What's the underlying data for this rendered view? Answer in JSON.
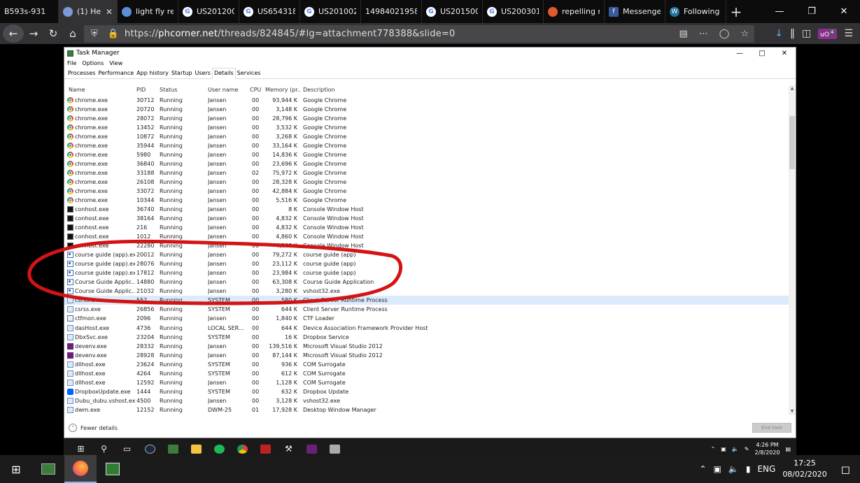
{
  "browser": {
    "tabs": [
      {
        "title": "B593s-931",
        "favicon": "none",
        "color": "#0c0c0d"
      },
      {
        "title": "(1) Hel",
        "favicon": "cube-icon",
        "color": "#7b9bd8",
        "active": true
      },
      {
        "title": "light fly re",
        "favicon": "bird-icon",
        "color": "#5a8fd8"
      },
      {
        "title": "US201200",
        "favicon": "google-icon",
        "color": "#ffffff"
      },
      {
        "title": "US654318",
        "favicon": "google-icon",
        "color": "#ffffff"
      },
      {
        "title": "US201002",
        "favicon": "google-icon",
        "color": "#ffffff"
      },
      {
        "title": "149840219585",
        "favicon": "none",
        "color": "#ffffff"
      },
      {
        "title": "US201500",
        "favicon": "google-icon",
        "color": "#ffffff"
      },
      {
        "title": "US200301",
        "favicon": "google-icon",
        "color": "#ffffff"
      },
      {
        "title": "repelling r",
        "favicon": "shield-icon",
        "color": "#e05a2b"
      },
      {
        "title": "Messenge",
        "favicon": "facebook-icon",
        "color": "#3b5998"
      },
      {
        "title": "Following",
        "favicon": "wordpress-icon",
        "color": "#21759b"
      }
    ],
    "new_tab": "+",
    "url_prefix": "https://",
    "url_domain": "phcorner.net",
    "url_path": "/threads/824845/#lg=attachment778388&slide=0",
    "extension_badge": "4"
  },
  "task_manager": {
    "title": "Task Manager",
    "menu": [
      "File",
      "Options",
      "View"
    ],
    "tabs": [
      "Processes",
      "Performance",
      "App history",
      "Startup",
      "Users",
      "Details",
      "Services"
    ],
    "active_tab": "Details",
    "columns": {
      "name": "Name",
      "pid": "PID",
      "status": "Status",
      "user": "User name",
      "cpu": "CPU",
      "mem": "Memory (pr...",
      "desc": "Description"
    },
    "rows": [
      {
        "name": "chrome.exe",
        "pid": "30712",
        "status": "Running",
        "user": "Jansen",
        "cpu": "00",
        "mem": "93,944 K",
        "desc": "Google Chrome",
        "icon": "chrome"
      },
      {
        "name": "chrome.exe",
        "pid": "20720",
        "status": "Running",
        "user": "Jansen",
        "cpu": "00",
        "mem": "3,148 K",
        "desc": "Google Chrome",
        "icon": "chrome"
      },
      {
        "name": "chrome.exe",
        "pid": "28072",
        "status": "Running",
        "user": "Jansen",
        "cpu": "00",
        "mem": "28,796 K",
        "desc": "Google Chrome",
        "icon": "chrome"
      },
      {
        "name": "chrome.exe",
        "pid": "13452",
        "status": "Running",
        "user": "Jansen",
        "cpu": "00",
        "mem": "3,532 K",
        "desc": "Google Chrome",
        "icon": "chrome"
      },
      {
        "name": "chrome.exe",
        "pid": "10872",
        "status": "Running",
        "user": "Jansen",
        "cpu": "00",
        "mem": "3,268 K",
        "desc": "Google Chrome",
        "icon": "chrome"
      },
      {
        "name": "chrome.exe",
        "pid": "35944",
        "status": "Running",
        "user": "Jansen",
        "cpu": "00",
        "mem": "33,164 K",
        "desc": "Google Chrome",
        "icon": "chrome"
      },
      {
        "name": "chrome.exe",
        "pid": "5980",
        "status": "Running",
        "user": "Jansen",
        "cpu": "00",
        "mem": "14,836 K",
        "desc": "Google Chrome",
        "icon": "chrome"
      },
      {
        "name": "chrome.exe",
        "pid": "36840",
        "status": "Running",
        "user": "Jansen",
        "cpu": "00",
        "mem": "23,696 K",
        "desc": "Google Chrome",
        "icon": "chrome"
      },
      {
        "name": "chrome.exe",
        "pid": "33188",
        "status": "Running",
        "user": "Jansen",
        "cpu": "02",
        "mem": "75,972 K",
        "desc": "Google Chrome",
        "icon": "chrome"
      },
      {
        "name": "chrome.exe",
        "pid": "26108",
        "status": "Running",
        "user": "Jansen",
        "cpu": "00",
        "mem": "28,328 K",
        "desc": "Google Chrome",
        "icon": "chrome"
      },
      {
        "name": "chrome.exe",
        "pid": "33072",
        "status": "Running",
        "user": "Jansen",
        "cpu": "00",
        "mem": "42,884 K",
        "desc": "Google Chrome",
        "icon": "chrome"
      },
      {
        "name": "chrome.exe",
        "pid": "10344",
        "status": "Running",
        "user": "Jansen",
        "cpu": "00",
        "mem": "5,516 K",
        "desc": "Google Chrome",
        "icon": "chrome"
      },
      {
        "name": "conhost.exe",
        "pid": "36740",
        "status": "Running",
        "user": "Jansen",
        "cpu": "00",
        "mem": "8 K",
        "desc": "Console Window Host",
        "icon": "console"
      },
      {
        "name": "conhost.exe",
        "pid": "38164",
        "status": "Running",
        "user": "Jansen",
        "cpu": "00",
        "mem": "4,832 K",
        "desc": "Console Window Host",
        "icon": "console"
      },
      {
        "name": "conhost.exe",
        "pid": "216",
        "status": "Running",
        "user": "Jansen",
        "cpu": "00",
        "mem": "4,832 K",
        "desc": "Console Window Host",
        "icon": "console"
      },
      {
        "name": "conhost.exe",
        "pid": "1012",
        "status": "Running",
        "user": "Jansen",
        "cpu": "00",
        "mem": "4,860 K",
        "desc": "Console Window Host",
        "icon": "console"
      },
      {
        "name": "conhost.exe",
        "pid": "22280",
        "status": "Running",
        "user": "Jansen",
        "cpu": "00",
        "mem": "4,868 K",
        "desc": "Console Window Host",
        "icon": "console"
      },
      {
        "name": "course guide (app).exe",
        "pid": "20012",
        "status": "Running",
        "user": "Jansen",
        "cpu": "00",
        "mem": "79,272 K",
        "desc": "course guide (app)",
        "icon": "app"
      },
      {
        "name": "course guide (app).exe",
        "pid": "28076",
        "status": "Running",
        "user": "Jansen",
        "cpu": "00",
        "mem": "23,112 K",
        "desc": "course guide (app)",
        "icon": "app"
      },
      {
        "name": "course guide (app).exe",
        "pid": "17812",
        "status": "Running",
        "user": "Jansen",
        "cpu": "00",
        "mem": "23,984 K",
        "desc": "course guide (app)",
        "icon": "app"
      },
      {
        "name": "Course Guide Applic...",
        "pid": "14880",
        "status": "Running",
        "user": "Jansen",
        "cpu": "00",
        "mem": "63,308 K",
        "desc": "Course Guide Application",
        "icon": "app"
      },
      {
        "name": "Course Guide Applic...",
        "pid": "21032",
        "status": "Running",
        "user": "Jansen",
        "cpu": "00",
        "mem": "3,280 K",
        "desc": "vshost32.exe",
        "icon": "app"
      },
      {
        "name": "csrss.exe",
        "pid": "552",
        "status": "Running",
        "user": "SYSTEM",
        "cpu": "00",
        "mem": "580 K",
        "desc": "Client Server Runtime Process",
        "icon": "sys",
        "selected": true
      },
      {
        "name": "csrss.exe",
        "pid": "26856",
        "status": "Running",
        "user": "SYSTEM",
        "cpu": "00",
        "mem": "644 K",
        "desc": "Client Server Runtime Process",
        "icon": "sys"
      },
      {
        "name": "ctfmon.exe",
        "pid": "2096",
        "status": "Running",
        "user": "Jansen",
        "cpu": "00",
        "mem": "1,840 K",
        "desc": "CTF Loader",
        "icon": "ctf"
      },
      {
        "name": "dasHost.exe",
        "pid": "4736",
        "status": "Running",
        "user": "LOCAL SER...",
        "cpu": "00",
        "mem": "644 K",
        "desc": "Device Association Framework Provider Host",
        "icon": "sys"
      },
      {
        "name": "DbxSvc.exe",
        "pid": "23204",
        "status": "Running",
        "user": "SYSTEM",
        "cpu": "00",
        "mem": "16 K",
        "desc": "Dropbox Service",
        "icon": "sys"
      },
      {
        "name": "devenv.exe",
        "pid": "28332",
        "status": "Running",
        "user": "Jansen",
        "cpu": "00",
        "mem": "139,516 K",
        "desc": "Microsoft Visual Studio 2012",
        "icon": "vs"
      },
      {
        "name": "devenv.exe",
        "pid": "28928",
        "status": "Running",
        "user": "Jansen",
        "cpu": "00",
        "mem": "87,144 K",
        "desc": "Microsoft Visual Studio 2012",
        "icon": "vs"
      },
      {
        "name": "dllhost.exe",
        "pid": "23624",
        "status": "Running",
        "user": "SYSTEM",
        "cpu": "00",
        "mem": "936 K",
        "desc": "COM Surrogate",
        "icon": "sys"
      },
      {
        "name": "dllhost.exe",
        "pid": "4264",
        "status": "Running",
        "user": "SYSTEM",
        "cpu": "00",
        "mem": "612 K",
        "desc": "COM Surrogate",
        "icon": "sys"
      },
      {
        "name": "dllhost.exe",
        "pid": "12592",
        "status": "Running",
        "user": "Jansen",
        "cpu": "00",
        "mem": "1,128 K",
        "desc": "COM Surrogate",
        "icon": "sys"
      },
      {
        "name": "DropboxUpdate.exe",
        "pid": "1444",
        "status": "Running",
        "user": "SYSTEM",
        "cpu": "00",
        "mem": "632 K",
        "desc": "Dropbox Update",
        "icon": "dropbox"
      },
      {
        "name": "Dubu_dubu.vshost.exe",
        "pid": "4500",
        "status": "Running",
        "user": "Jansen",
        "cpu": "00",
        "mem": "3,128 K",
        "desc": "vshost32.exe",
        "icon": "sys"
      },
      {
        "name": "dwm.exe",
        "pid": "12152",
        "status": "Running",
        "user": "DWM-25",
        "cpu": "01",
        "mem": "17,928 K",
        "desc": "Desktop Window Manager",
        "icon": "sys"
      }
    ],
    "fewer_details": "Fewer details",
    "end_task": "End task"
  },
  "inner_taskbar": {
    "time": "4:26 PM",
    "date": "2/8/2020"
  },
  "outer_taskbar": {
    "language": "ENG",
    "time": "17:25",
    "date": "08/02/2020"
  },
  "colors": {
    "annotation": "#d41414",
    "selection": "#dcebfc"
  }
}
